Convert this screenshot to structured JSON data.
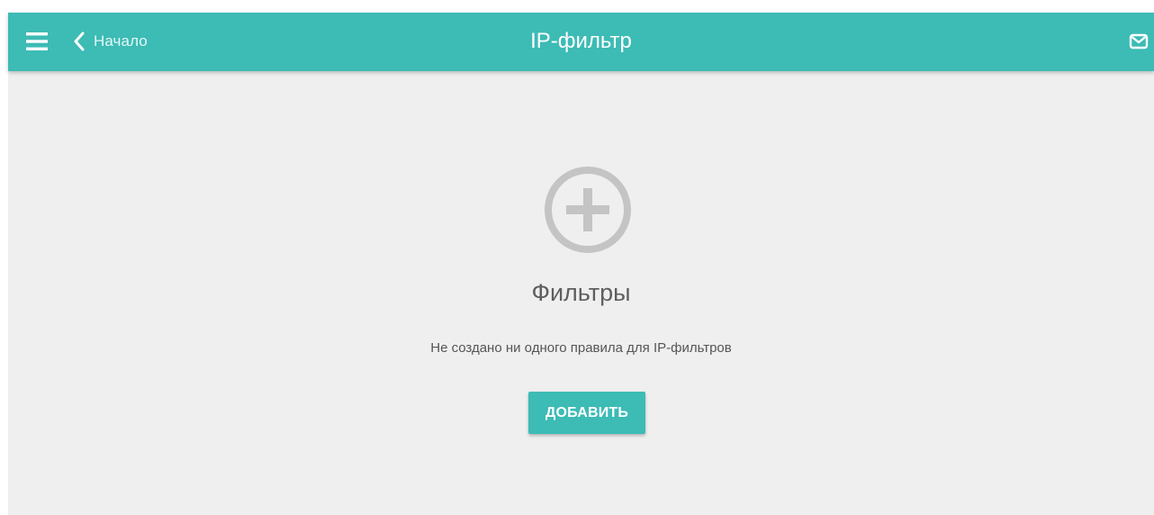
{
  "header": {
    "back_label": "Начало",
    "title": "IP-фильтр",
    "icons": {
      "menu": "hamburger-menu-icon",
      "back": "chevron-left-icon",
      "messages": "envelope-icon"
    },
    "colors": {
      "background": "#3dbbb5",
      "title_text": "#ffffff"
    }
  },
  "empty_state": {
    "icon": "plus-circle-icon",
    "title": "Фильтры",
    "description": "Не создано ни одного правила для IP-фильтров",
    "add_button_label": "ДОБАВИТЬ",
    "colors": {
      "page_background": "#efefef",
      "icon": "#c4c4c4",
      "button": "#3dbbb5"
    }
  }
}
